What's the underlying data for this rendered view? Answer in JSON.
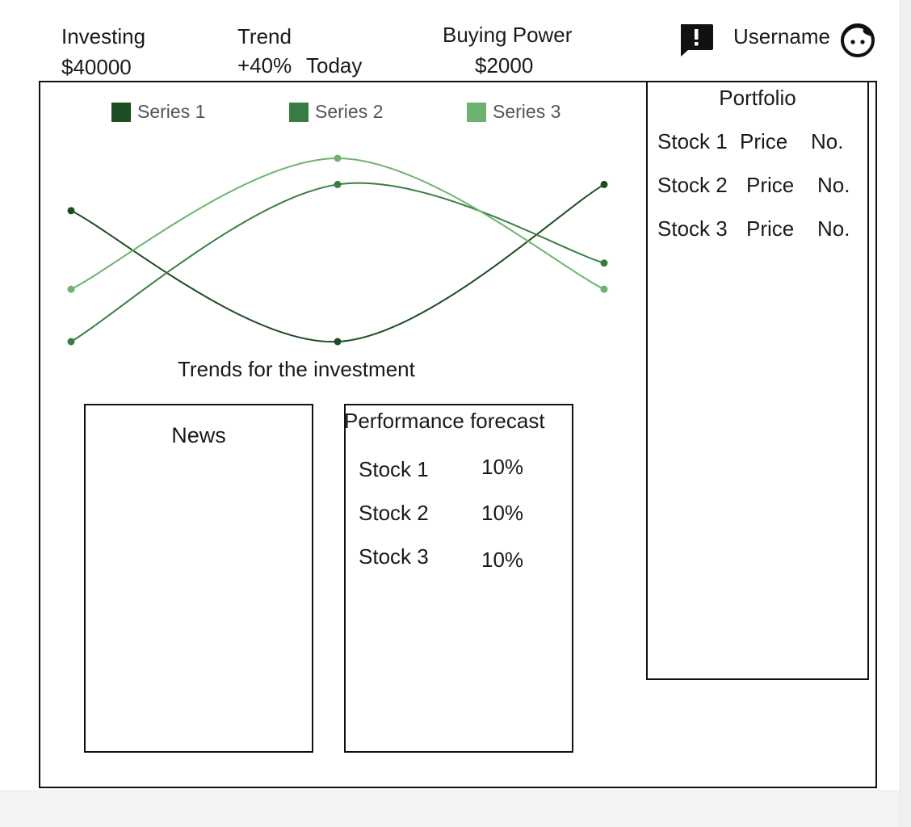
{
  "header": {
    "investing_label": "Investing",
    "investing_value": "$40000",
    "trend_label": "Trend",
    "trend_value": "+40%",
    "trend_period": "Today",
    "buying_power_label": "Buying Power",
    "buying_power_value": "$2000",
    "username": "Username",
    "icons": {
      "feedback": "feedback-icon",
      "avatar": "avatar-face-icon"
    }
  },
  "chart_data": {
    "type": "line",
    "title": "Trends for the investment",
    "x": [
      1,
      2,
      3
    ],
    "series": [
      {
        "name": "Series 1",
        "values": [
          50,
          0,
          60
        ],
        "color": "#1e4d23"
      },
      {
        "name": "Series 2",
        "values": [
          0,
          60,
          30
        ],
        "color": "#3a7d44"
      },
      {
        "name": "Series 3",
        "values": [
          20,
          70,
          20
        ],
        "color": "#6db36f"
      }
    ],
    "ylim": [
      0,
      70
    ],
    "legend_position": "top",
    "grid": false,
    "smooth": true
  },
  "news": {
    "title": "News"
  },
  "forecast": {
    "title": "Performance forecast",
    "rows": [
      {
        "stock": "Stock 1",
        "value": "10%"
      },
      {
        "stock": "Stock 2",
        "value": "10%"
      },
      {
        "stock": "Stock 3",
        "value": "10%"
      }
    ]
  },
  "portfolio": {
    "title": "Portfolio",
    "rows": [
      {
        "stock": "Stock 1",
        "price": "Price",
        "no": "No."
      },
      {
        "stock": "Stock 2",
        "price": "Price",
        "no": "No."
      },
      {
        "stock": "Stock 3",
        "price": "Price",
        "no": "No."
      }
    ]
  }
}
